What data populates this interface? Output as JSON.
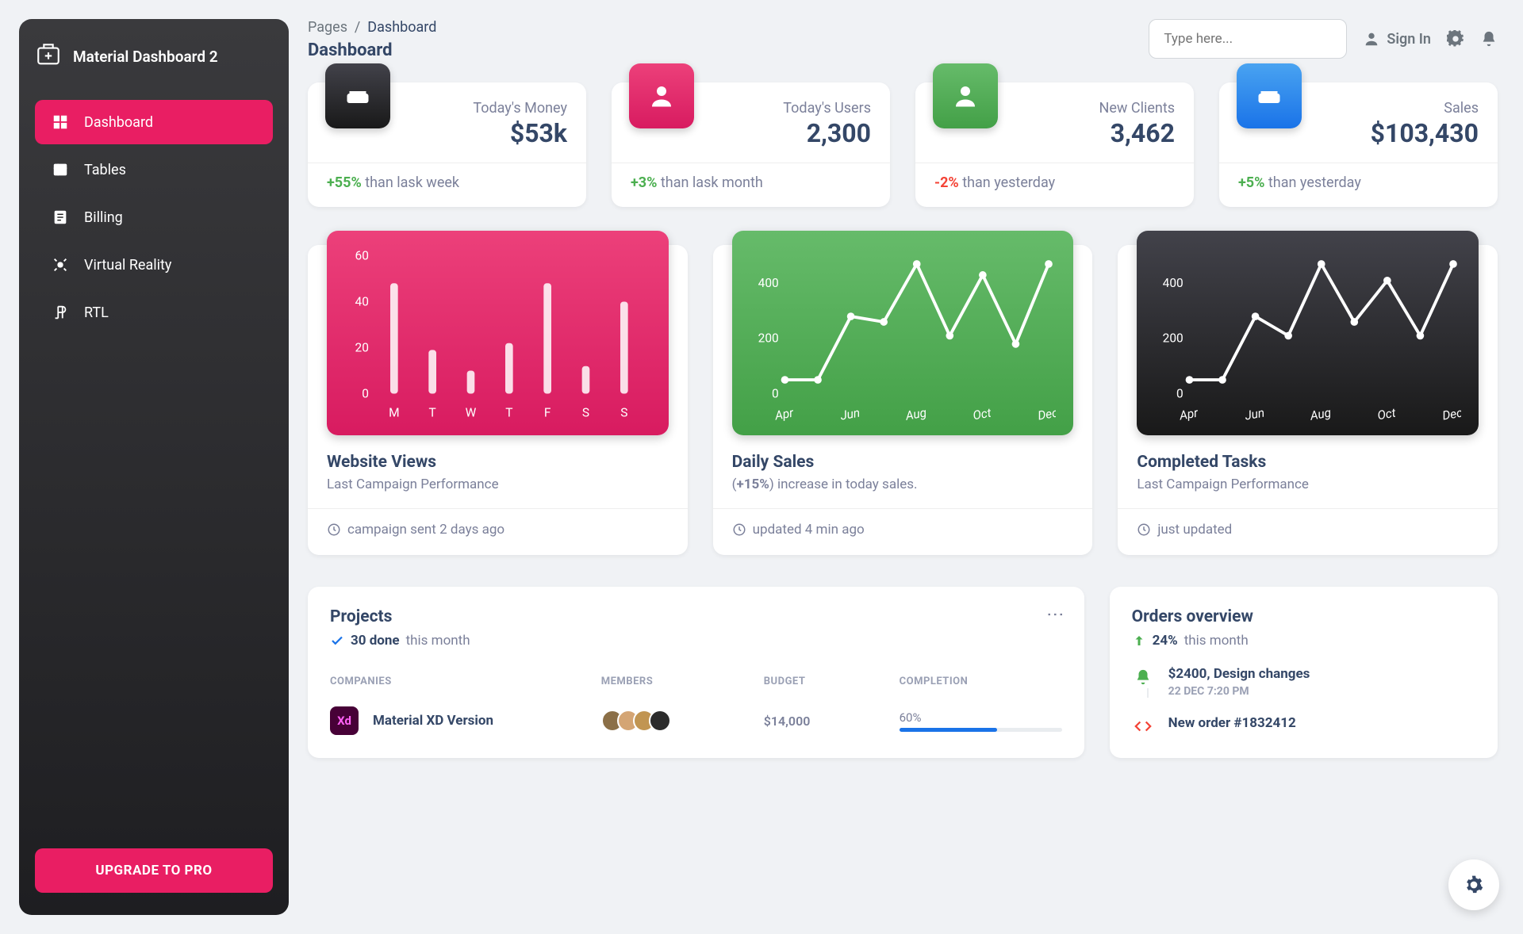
{
  "brand": "Material Dashboard 2",
  "sidebar": {
    "items": [
      {
        "label": "Dashboard"
      },
      {
        "label": "Tables"
      },
      {
        "label": "Billing"
      },
      {
        "label": "Virtual Reality"
      },
      {
        "label": "RTL"
      }
    ],
    "upgrade": "UPGRADE TO PRO"
  },
  "breadcrumb": {
    "root": "Pages",
    "sep": "/",
    "current": "Dashboard"
  },
  "page_title": "Dashboard",
  "search": {
    "placeholder": "Type here..."
  },
  "signin": "Sign In",
  "stats": [
    {
      "label": "Today's Money",
      "value": "$53k",
      "delta": "+55%",
      "delta_cls": "pos",
      "tail": " than lask week"
    },
    {
      "label": "Today's Users",
      "value": "2,300",
      "delta": "+3%",
      "delta_cls": "pos",
      "tail": " than lask month"
    },
    {
      "label": "New Clients",
      "value": "3,462",
      "delta": "-2%",
      "delta_cls": "neg",
      "tail": " than yesterday"
    },
    {
      "label": "Sales",
      "value": "$103,430",
      "delta": "+5%",
      "delta_cls": "pos",
      "tail": " than yesterday"
    }
  ],
  "charts": [
    {
      "title": "Website Views",
      "sub": "Last Campaign Performance",
      "foot": "campaign sent 2 days ago"
    },
    {
      "title": "Daily Sales",
      "sub_pre": "(",
      "sub_bold": "+15%",
      "sub_post": ") increase in today sales.",
      "foot": "updated 4 min ago"
    },
    {
      "title": "Completed Tasks",
      "sub": "Last Campaign Performance",
      "foot": "just updated"
    }
  ],
  "chart_data": [
    {
      "type": "bar",
      "title": "Website Views",
      "categories": [
        "M",
        "T",
        "W",
        "T",
        "F",
        "S",
        "S"
      ],
      "values": [
        48,
        19,
        10,
        22,
        48,
        12,
        40
      ],
      "ylabel": "",
      "ylim": [
        0,
        60
      ],
      "yticks": [
        0,
        20,
        40,
        60
      ]
    },
    {
      "type": "line",
      "title": "Daily Sales",
      "x": [
        "Apr",
        "Jun",
        "Aug",
        "Oct",
        "Dec"
      ],
      "values": [
        50,
        50,
        280,
        260,
        470,
        210,
        430,
        180,
        470
      ],
      "ylim": [
        0,
        500
      ],
      "yticks": [
        0,
        200,
        400
      ]
    },
    {
      "type": "line",
      "title": "Completed Tasks",
      "x": [
        "Apr",
        "Jun",
        "Aug",
        "Oct",
        "Dec"
      ],
      "values": [
        50,
        50,
        280,
        210,
        470,
        260,
        410,
        210,
        470
      ],
      "ylim": [
        0,
        500
      ],
      "yticks": [
        0,
        200,
        400
      ]
    }
  ],
  "projects": {
    "title": "Projects",
    "done_count": "30 done",
    "done_tail": " this month",
    "columns": [
      "COMPANIES",
      "MEMBERS",
      "BUDGET",
      "COMPLETION"
    ],
    "rows": [
      {
        "company": "Material XD Version",
        "icon": "Xd",
        "budget": "$14,000",
        "completion": "60%",
        "completion_n": 60
      }
    ]
  },
  "orders": {
    "title": "Orders overview",
    "delta": "24%",
    "delta_tail": " this month",
    "items": [
      {
        "title": "$2400, Design changes",
        "date": "22 DEC 7:20 PM",
        "icon": "bell",
        "color": "#4caf50"
      },
      {
        "title": "New order #1832412",
        "date": "",
        "icon": "code",
        "color": "#f44336"
      }
    ]
  }
}
